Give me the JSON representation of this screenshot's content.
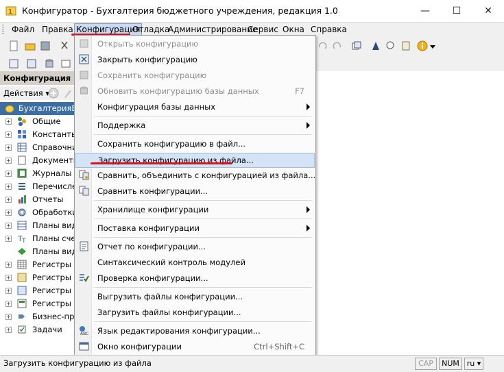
{
  "window": {
    "title": "Конфигуратор - Бухгалтерия бюджетного учреждения, редакция 1.0",
    "minimize": "—",
    "maximize": "☐",
    "close": "✕"
  },
  "menubar": {
    "items": [
      "Файл",
      "Правка",
      "Конфигурация",
      "Отладка",
      "Администрирование",
      "Сервис",
      "Окна",
      "Справка"
    ]
  },
  "left_panel": {
    "title": "Конфигурация",
    "actions_label": "Действия ▾",
    "tree": [
      {
        "label": "БухгалтерияБюд",
        "icon": "config-root-icon"
      },
      {
        "label": "Общие",
        "icon": "common-icon"
      },
      {
        "label": "Константы",
        "icon": "constants-icon"
      },
      {
        "label": "Справочники",
        "icon": "catalogs-icon"
      },
      {
        "label": "Документы",
        "icon": "documents-icon"
      },
      {
        "label": "Журналы до",
        "icon": "journals-icon"
      },
      {
        "label": "Перечислен",
        "icon": "enums-icon"
      },
      {
        "label": "Отчеты",
        "icon": "reports-icon"
      },
      {
        "label": "Обработки",
        "icon": "processing-icon"
      },
      {
        "label": "Планы видо",
        "icon": "plans-icon"
      },
      {
        "label": "Планы счето",
        "icon": "accounts-plans-icon"
      },
      {
        "label": "Планы видо",
        "icon": "calc-plans-icon"
      },
      {
        "label": "Регистры св",
        "icon": "info-registers-icon"
      },
      {
        "label": "Регистры на",
        "icon": "accum-registers-icon"
      },
      {
        "label": "Регистры бу",
        "icon": "acct-registers-icon"
      },
      {
        "label": "Регистры ра",
        "icon": "calc-registers-icon"
      },
      {
        "label": "Бизнес-проц",
        "icon": "business-process-icon"
      },
      {
        "label": "Задачи",
        "icon": "tasks-icon"
      }
    ]
  },
  "dropdown": {
    "items": [
      {
        "label": "Открыть конфигурацию",
        "shortcut": "",
        "disabled": true,
        "submenu": false,
        "icon": "open-config-icon"
      },
      {
        "label": "Закрыть конфигурацию",
        "shortcut": "",
        "disabled": false,
        "submenu": false,
        "icon": "close-config-icon"
      },
      {
        "label": "Сохранить конфигурацию",
        "shortcut": "",
        "disabled": true,
        "submenu": false,
        "icon": "save-config-icon"
      },
      {
        "label": "Обновить конфигурацию базы данных",
        "shortcut": "F7",
        "disabled": true,
        "submenu": false,
        "icon": "update-db-icon"
      },
      {
        "label": "Конфигурация базы данных",
        "shortcut": "",
        "disabled": false,
        "submenu": true,
        "icon": ""
      },
      {
        "label": "Поддержка",
        "shortcut": "",
        "disabled": false,
        "submenu": true,
        "icon": ""
      },
      {
        "label": "Сохранить конфигурацию в файл...",
        "shortcut": "",
        "disabled": false,
        "submenu": false,
        "icon": ""
      },
      {
        "label": "Загрузить конфигурацию из файла...",
        "shortcut": "",
        "disabled": false,
        "submenu": false,
        "icon": ""
      },
      {
        "label": "Сравнить, объединить с конфигурацией из файла...",
        "shortcut": "",
        "disabled": false,
        "submenu": false,
        "icon": "compare-merge-icon"
      },
      {
        "label": "Сравнить конфигурации...",
        "shortcut": "",
        "disabled": false,
        "submenu": false,
        "icon": "compare-icon"
      },
      {
        "label": "Хранилище конфигурации",
        "shortcut": "",
        "disabled": false,
        "submenu": true,
        "icon": ""
      },
      {
        "label": "Поставка конфигурации",
        "shortcut": "",
        "disabled": false,
        "submenu": true,
        "icon": ""
      },
      {
        "label": "Отчет по конфигурации...",
        "shortcut": "",
        "disabled": false,
        "submenu": false,
        "icon": "report-icon"
      },
      {
        "label": "Синтаксический контроль модулей",
        "shortcut": "",
        "disabled": false,
        "submenu": false,
        "icon": ""
      },
      {
        "label": "Проверка конфигурации...",
        "shortcut": "",
        "disabled": false,
        "submenu": false,
        "icon": "check-icon"
      },
      {
        "label": "Выгрузить файлы конфигурации...",
        "shortcut": "",
        "disabled": false,
        "submenu": false,
        "icon": ""
      },
      {
        "label": "Загрузить файлы конфигурации...",
        "shortcut": "",
        "disabled": false,
        "submenu": false,
        "icon": ""
      },
      {
        "label": "Язык редактирования конфигурации...",
        "shortcut": "",
        "disabled": false,
        "submenu": false,
        "icon": "language-icon"
      },
      {
        "label": "Окно конфигурации",
        "shortcut": "Ctrl+Shift+C",
        "disabled": false,
        "submenu": false,
        "icon": "config-window-icon"
      }
    ]
  },
  "statusbar": {
    "text": "Загрузить конфигурацию из файла",
    "cap": "CAP",
    "num": "NUM",
    "lang": "ru ▾"
  },
  "colors": {
    "highlight": "#d5e3f7",
    "annotation_red": "#d9141c",
    "selected_tree": "#3a6ea5"
  }
}
